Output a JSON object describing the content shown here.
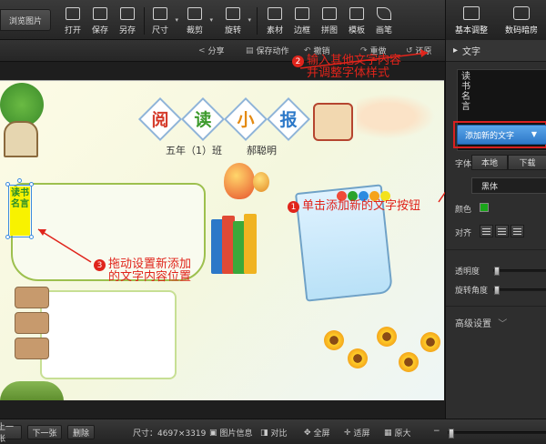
{
  "toolbar": {
    "browse_label": "浏览图片",
    "tools": [
      {
        "label": "打开",
        "icon": "open-icon"
      },
      {
        "label": "保存",
        "icon": "save-icon"
      },
      {
        "label": "另存",
        "icon": "save-as-icon"
      },
      {
        "label": "尺寸",
        "icon": "resize-icon"
      },
      {
        "label": "裁剪",
        "icon": "crop-icon"
      },
      {
        "label": "旋转",
        "icon": "rotate-icon"
      },
      {
        "label": "素材",
        "icon": "material-icon"
      },
      {
        "label": "边框",
        "icon": "border-icon"
      },
      {
        "label": "拼图",
        "icon": "collage-icon"
      },
      {
        "label": "模板",
        "icon": "template-icon"
      },
      {
        "label": "画笔",
        "icon": "brush-icon"
      }
    ],
    "right": [
      {
        "label": "基本调整",
        "icon": "adjust-icon"
      },
      {
        "label": "数码暗房",
        "icon": "camera-icon"
      }
    ]
  },
  "subbar": {
    "share": "分享",
    "save_action": "保存动作",
    "undo": "撤销",
    "redo": "重做",
    "restore": "还原"
  },
  "poster": {
    "title_chars": [
      "阅",
      "读",
      "小",
      "报"
    ],
    "title_colors": [
      "#d53a2a",
      "#3c9a2c",
      "#e48a12",
      "#2c78c8"
    ],
    "grade": "五年（1）班",
    "author": "郝聪明",
    "vertical_text": "读书名言",
    "dot_colors": [
      "#f04b3a",
      "#2aa32a",
      "#2c8be0",
      "#f5a31b",
      "#f3e21d"
    ]
  },
  "annotations": {
    "a1": {
      "num": "1",
      "text": "单击添加新的文字按钮"
    },
    "a2": {
      "num": "2",
      "text": "输入其他文字内容",
      "text2": "并调整字体样式"
    },
    "a3": {
      "num": "3",
      "text": "拖动设置新添加",
      "text2": "的文字内容位置"
    }
  },
  "panel": {
    "header": "文字",
    "text_value": "读书名言",
    "add_button": "添加新的文字",
    "font_label": "字体",
    "font_tabs": [
      "本地",
      "下载"
    ],
    "font_name": "黑体",
    "color_label": "颜色",
    "color_value": "#1aa51a",
    "align_label": "对齐",
    "opacity_label": "透明度",
    "opacity_value": 0.02,
    "rotation_label": "旋转角度",
    "rotation_value": 0.02,
    "advanced": "高级设置"
  },
  "statusbar": {
    "prev": "上一张",
    "next": "下一张",
    "delete": "删除",
    "size_label": "尺寸：4697×3319",
    "info": "图片信息",
    "compare": "对比",
    "fullscreen": "全屏",
    "fit": "适屏",
    "original": "原大",
    "zoom_value": 0.01
  }
}
